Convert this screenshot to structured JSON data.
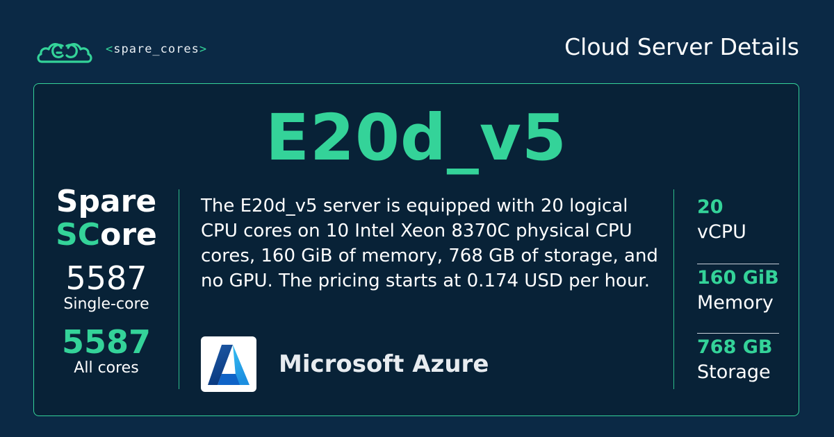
{
  "header": {
    "brand": "spare_cores",
    "brand_open": "<",
    "brand_close": ">",
    "page_title": "Cloud Server Details"
  },
  "server": {
    "name": "E20d_v5",
    "description": "The E20d_v5 server is equipped with 20 logical CPU cores on 10 Intel Xeon 8370C physical CPU cores, 160 GiB of memory, 768 GB of storage, and no GPU. The pricing starts at 0.174 USD per hour."
  },
  "score": {
    "title_line1": "Spare",
    "title_line2_accent": "SC",
    "title_line2_rest": "ore",
    "single_core_value": "5587",
    "single_core_label": "Single-core",
    "all_cores_value": "5587",
    "all_cores_label": "All cores"
  },
  "provider": {
    "name": "Microsoft Azure",
    "logo_icon": "azure-logo-icon"
  },
  "specs": [
    {
      "value": "20",
      "label": "vCPU"
    },
    {
      "value": "160 GiB",
      "label": "Memory"
    },
    {
      "value": "768 GB",
      "label": "Storage"
    }
  ],
  "colors": {
    "background": "#0b2945",
    "card": "#082237",
    "accent": "#34d399"
  }
}
